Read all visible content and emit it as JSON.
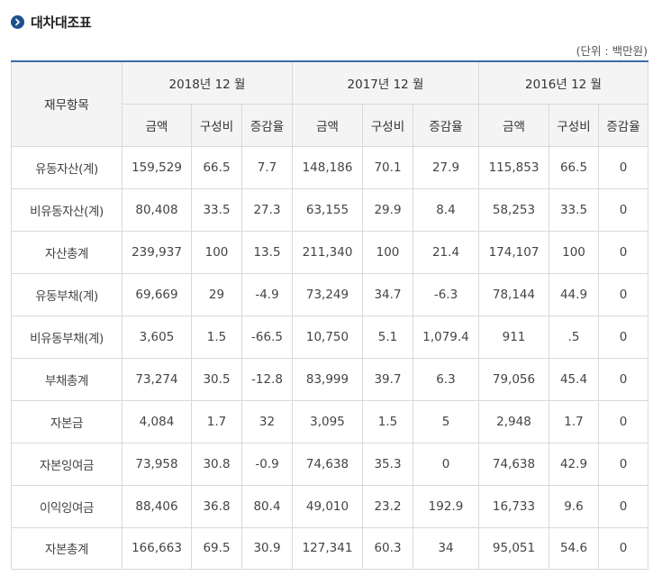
{
  "page": {
    "title": "대차대조표",
    "unit_note": "(단위 : 백만원)",
    "title_icon": "chevron-right-circle-icon",
    "accent_color": "#1d4f8f",
    "header_border_color": "#3b6aa7"
  },
  "table": {
    "item_header": "재무항목",
    "periods": [
      "2018년 12 월",
      "2017년 12 월",
      "2016년 12 월"
    ],
    "subheaders": [
      "금액",
      "구성비",
      "증감율"
    ],
    "rows": [
      {
        "item": "유동자산(계)",
        "cells": [
          "159,529",
          "66.5",
          "7.7",
          "148,186",
          "70.1",
          "27.9",
          "115,853",
          "66.5",
          "0"
        ]
      },
      {
        "item": "비유동자산(계)",
        "cells": [
          "80,408",
          "33.5",
          "27.3",
          "63,155",
          "29.9",
          "8.4",
          "58,253",
          "33.5",
          "0"
        ]
      },
      {
        "item": "자산총계",
        "cells": [
          "239,937",
          "100",
          "13.5",
          "211,340",
          "100",
          "21.4",
          "174,107",
          "100",
          "0"
        ]
      },
      {
        "item": "유동부채(계)",
        "cells": [
          "69,669",
          "29",
          "-4.9",
          "73,249",
          "34.7",
          "-6.3",
          "78,144",
          "44.9",
          "0"
        ]
      },
      {
        "item": "비유동부채(계)",
        "cells": [
          "3,605",
          "1.5",
          "-66.5",
          "10,750",
          "5.1",
          "1,079.4",
          "911",
          ".5",
          "0"
        ]
      },
      {
        "item": "부채총계",
        "cells": [
          "73,274",
          "30.5",
          "-12.8",
          "83,999",
          "39.7",
          "6.3",
          "79,056",
          "45.4",
          "0"
        ]
      },
      {
        "item": "자본금",
        "cells": [
          "4,084",
          "1.7",
          "32",
          "3,095",
          "1.5",
          "5",
          "2,948",
          "1.7",
          "0"
        ]
      },
      {
        "item": "자본잉여금",
        "cells": [
          "73,958",
          "30.8",
          "-0.9",
          "74,638",
          "35.3",
          "0",
          "74,638",
          "42.9",
          "0"
        ]
      },
      {
        "item": "이익잉여금",
        "cells": [
          "88,406",
          "36.8",
          "80.4",
          "49,010",
          "23.2",
          "192.9",
          "16,733",
          "9.6",
          "0"
        ]
      },
      {
        "item": "자본총계",
        "cells": [
          "166,663",
          "69.5",
          "30.9",
          "127,341",
          "60.3",
          "34",
          "95,051",
          "54.6",
          "0"
        ]
      }
    ]
  }
}
